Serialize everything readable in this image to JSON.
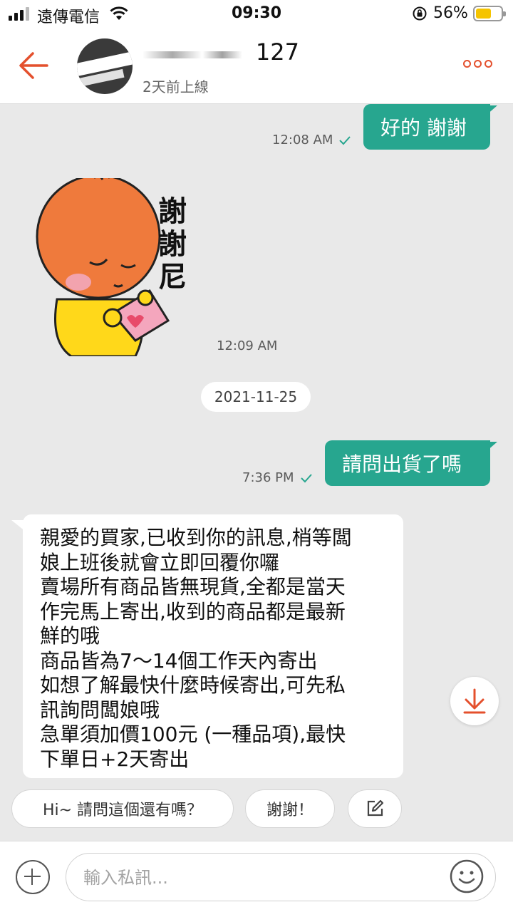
{
  "status_bar": {
    "carrier": "遠傳電信",
    "time": "09:30",
    "battery_percent": "56%",
    "battery_level": 0.56,
    "icons": [
      "signal-icon",
      "wifi-icon",
      "orientation-lock-icon",
      "battery-icon"
    ]
  },
  "header": {
    "contact_name_visible": "127",
    "last_seen": "2天前上線",
    "icons": [
      "back-arrow-icon",
      "more-options-icon"
    ]
  },
  "messages": [
    {
      "direction": "out",
      "text": "好的 謝謝",
      "time": "12:08 AM",
      "read": true
    },
    {
      "direction": "in",
      "type": "sticker",
      "sticker_text": "謝謝尼",
      "time": "12:09 AM"
    },
    {
      "type": "date",
      "text": "2021-11-25"
    },
    {
      "direction": "out",
      "text": "請問出貨了嗎",
      "time": "7:36 PM",
      "read": true
    },
    {
      "direction": "in",
      "text": "親愛的買家,已收到你的訊息,梢等闆\n娘上班後就會立即回覆你囉\n賣場所有商品皆無現貨,全都是當天\n作完馬上寄出,收到的商品都是最新\n鮮的哦\n商品皆為7～14個工作天內寄出\n如想了解最快什麼時候寄出,可先私\n訊詢問闆娘哦\n急單須加價100元 (一種品項),最快\n下單日+2天寄出"
    }
  ],
  "quick_replies": [
    "Hi~ 請問這個還有嗎？",
    "謝謝！"
  ],
  "input": {
    "placeholder": "輸入私訊..."
  },
  "colors": {
    "accent": "#e4502d",
    "bubble_out": "#27a68f",
    "background": "#e9e9e9"
  }
}
